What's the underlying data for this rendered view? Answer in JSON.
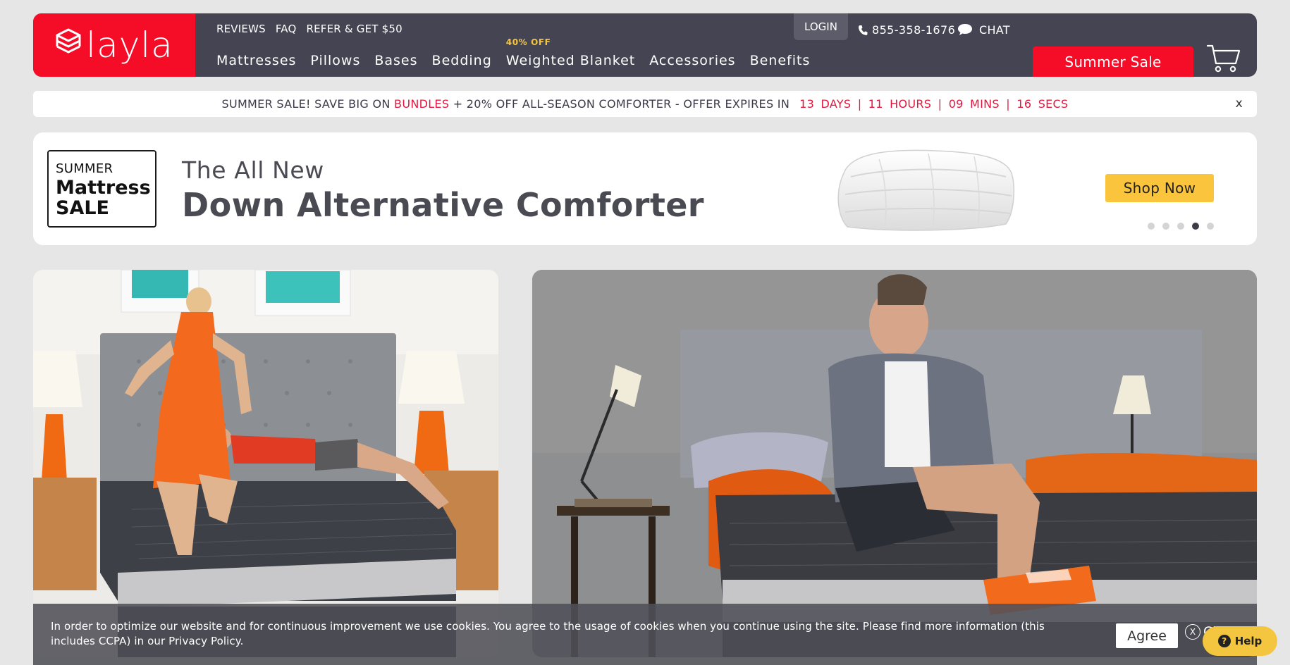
{
  "brand": {
    "name": "layla"
  },
  "header": {
    "utility_links": [
      "REVIEWS",
      "FAQ",
      "REFER & GET $50"
    ],
    "nav": [
      {
        "label": "Mattresses",
        "promo": ""
      },
      {
        "label": "Pillows",
        "promo": ""
      },
      {
        "label": "Bases",
        "promo": ""
      },
      {
        "label": "Bedding",
        "promo": ""
      },
      {
        "label": "Weighted Blanket",
        "promo": "40% OFF"
      },
      {
        "label": "Accessories",
        "promo": ""
      },
      {
        "label": "Benefits",
        "promo": ""
      }
    ],
    "login_label": "LOGIN",
    "phone": "855-358-1676",
    "chat_label": "CHAT",
    "sale_button_label": "Summer Sale"
  },
  "announcement": {
    "text_before": "SUMMER SALE! SAVE BIG ON",
    "highlight": "BUNDLES",
    "text_after": "+ 20% OFF ALL-SEASON COMFORTER - OFFER EXPIRES IN",
    "countdown": "13  DAYS |  11  HOURS | 09  MINS |  16  SECS",
    "close_label": "x"
  },
  "banner": {
    "badge_line1": "SUMMER",
    "badge_line2": "Mattress",
    "badge_line3": "SALE",
    "title_line1": "The All New",
    "title_line2": "Down Alternative Comforter",
    "cta_label": "Shop Now",
    "slide_count": 5,
    "active_slide": 4
  },
  "cookie": {
    "text": "In order to optimize our website and for continuous improvement we use cookies. You agree to the usage of cookies when you continue using the site. Please find more information (this includes CCPA) in our Privacy Policy.",
    "agree_label": "Agree",
    "close_label": "Close",
    "close_icon": "X"
  },
  "help": {
    "label": "Help"
  },
  "colors": {
    "brand_red": "#f50d28",
    "header_dark": "#454452",
    "accent_yellow": "#fac43d",
    "countdown_red": "#e3173e"
  }
}
